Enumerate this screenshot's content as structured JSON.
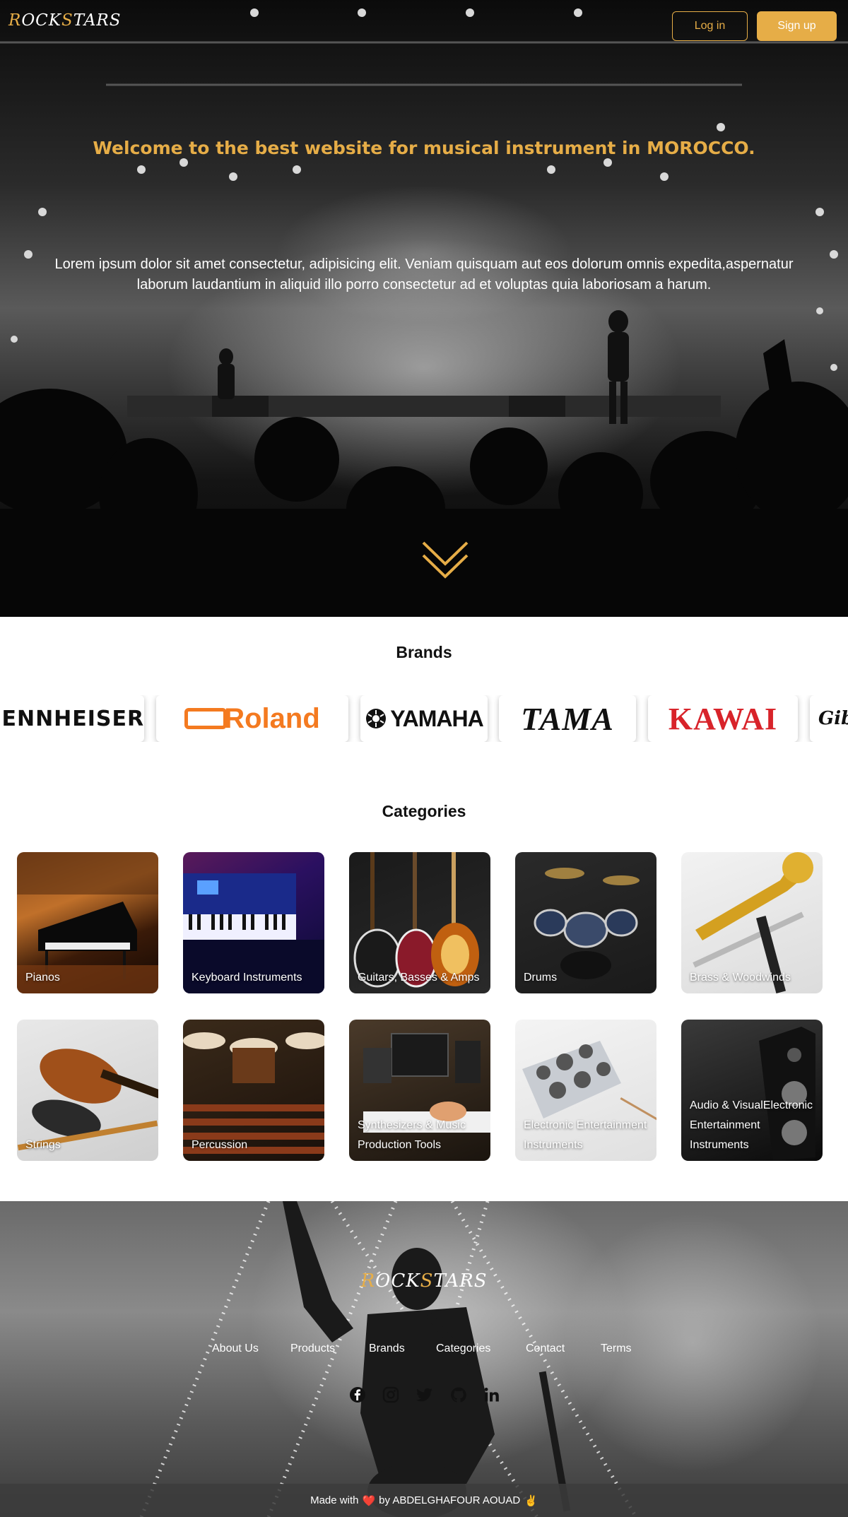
{
  "header": {
    "logo_first": "R",
    "logo_mid": "OCK",
    "logo_s": "S",
    "logo_end": "TARS",
    "login_label": "Log in",
    "signup_label": "Sign up"
  },
  "hero": {
    "title": "Welcome to the best website for musical instrument in MOROCCO.",
    "text": "Lorem ipsum dolor sit amet consectetur, adipisicing elit. Veniam quisquam aut eos dolorum omnis expedita,aspernatur laborum laudantium in aliquid illo porro consectetur ad et voluptas quia laboriosam a harum.",
    "scroll_icon": "double-chevron-down-icon"
  },
  "brands": {
    "title": "Brands",
    "items": [
      {
        "name": "SENNHEISER",
        "color": "#111111"
      },
      {
        "name": "Roland",
        "color": "#f47a20"
      },
      {
        "name": "YAMAHA",
        "color": "#111111"
      },
      {
        "name": "TAMA",
        "color": "#111111"
      },
      {
        "name": "KAWAI",
        "color": "#d8232a"
      },
      {
        "name": "Gibson",
        "color": "#111111"
      }
    ]
  },
  "categories": {
    "title": "Categories",
    "items": [
      {
        "label": "Pianos"
      },
      {
        "label": "Keyboard Instruments"
      },
      {
        "label": "Guitars, Basses & Amps"
      },
      {
        "label": "Drums"
      },
      {
        "label": "Brass & Woodwinds"
      },
      {
        "label": "Strings"
      },
      {
        "label": "Percussion"
      },
      {
        "label": "Synthesizers & Music Production Tools"
      },
      {
        "label": "Electronic Entertainment Instruments"
      },
      {
        "label": "Audio & VisualElectronic Entertainment Instruments"
      }
    ]
  },
  "footer": {
    "logo_first": "R",
    "logo_mid": "OCK",
    "logo_s": "S",
    "logo_end": "TARS",
    "nav": [
      "About Us",
      "Products",
      "Brands",
      "Categories",
      "Contact",
      "Terms"
    ],
    "socials": [
      "facebook-icon",
      "instagram-icon",
      "twitter-icon",
      "github-icon",
      "linkedin-icon"
    ],
    "made_with": "Made with",
    "heart": "❤️",
    "by": "by ABDELGHAFOUR AOUAD",
    "trailing_icon": "✌"
  },
  "colors": {
    "accent": "#e6ad47",
    "footer_bar": "#3c3c3c"
  }
}
